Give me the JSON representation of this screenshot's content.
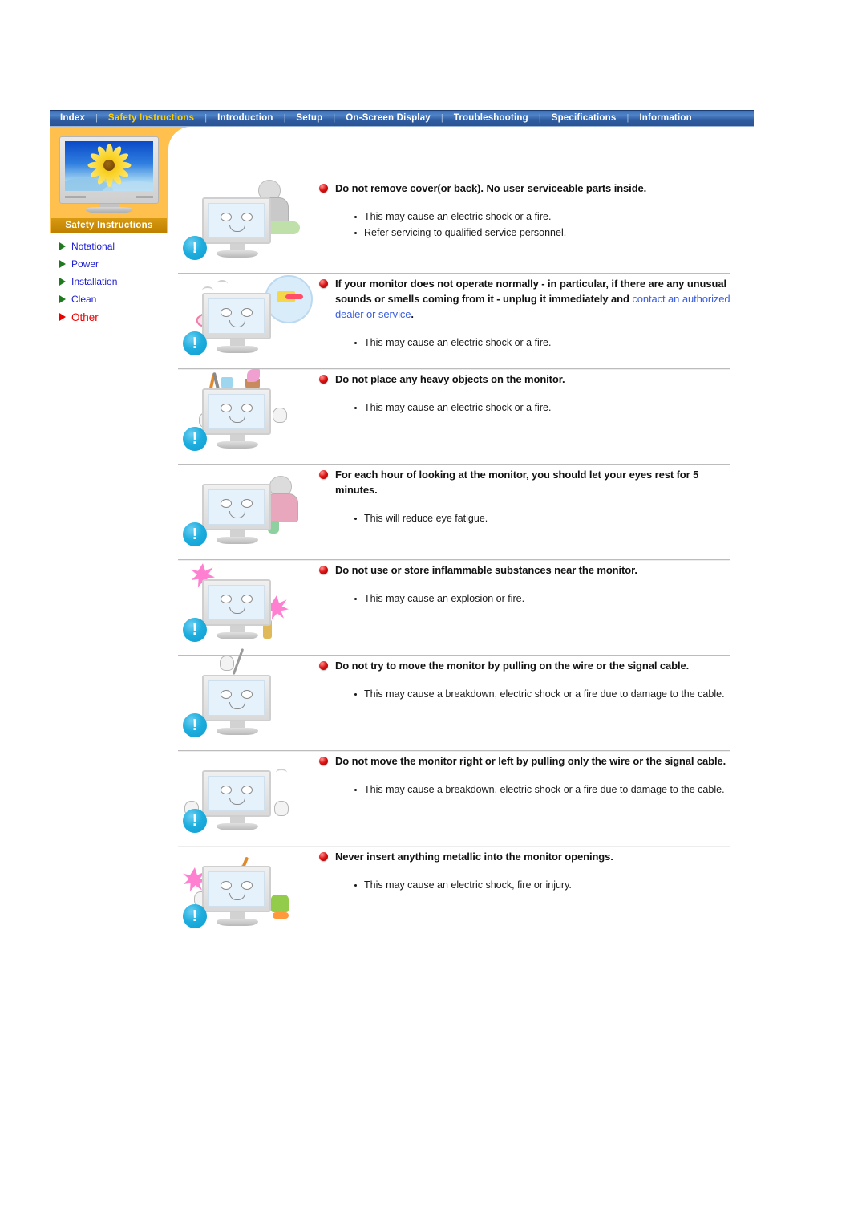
{
  "nav": {
    "separator": "|",
    "items": [
      {
        "label": "Index",
        "active": false
      },
      {
        "label": "Safety Instructions",
        "active": true
      },
      {
        "label": "Introduction",
        "active": false
      },
      {
        "label": "Setup",
        "active": false
      },
      {
        "label": "On-Screen Display",
        "active": false
      },
      {
        "label": "Troubleshooting",
        "active": false
      },
      {
        "label": "Specifications",
        "active": false
      },
      {
        "label": "Information",
        "active": false
      }
    ]
  },
  "sidebar": {
    "banner_label": "Safety Instructions",
    "thumbnail_alt": "monitor-with-sunflower-wallpaper",
    "items": [
      {
        "label": "Notational",
        "current": false
      },
      {
        "label": "Power",
        "current": false
      },
      {
        "label": "Installation",
        "current": false
      },
      {
        "label": "Clean",
        "current": false
      },
      {
        "label": "Other",
        "current": true
      }
    ]
  },
  "colors": {
    "nav_bar_blue": "#3f6fb5",
    "nav_active_yellow": "#ffd000",
    "sidebar_orange": "#ffc04d",
    "banner_gold": "#c08000",
    "link_blue": "#3b5fe0",
    "side_link_blue": "#1c1cd0",
    "current_red": "#ee0000",
    "heading_orb_red": "#e01515",
    "warn_icon_blue": "#1eaede",
    "rule_grey": "#bcbcbc"
  },
  "sections": [
    {
      "icon": "blue-exclamation-icon",
      "illustration": "technician-opening-monitor-cover",
      "heading": "Do not remove cover(or back). No user serviceable parts inside.",
      "heading_link": "",
      "heading_tail": "",
      "bullets": [
        "This may cause an electric shock or a fire.",
        "Refer servicing to qualified service personnel."
      ]
    },
    {
      "icon": "blue-exclamation-icon",
      "illustration": "monitor-smoking-unplug-and-call-service",
      "heading": "If your monitor does not operate normally - in particular, if there are any unusual sounds or smells coming from it - unplug it immediately and ",
      "heading_link": "contact an authorized dealer or service",
      "heading_tail": ".",
      "bullets": [
        "This may cause an electric shock or a fire."
      ]
    },
    {
      "icon": "blue-exclamation-icon",
      "illustration": "angry-monitor-with-objects-on-top",
      "heading": "Do not place any heavy objects on the monitor.",
      "heading_link": "",
      "heading_tail": "",
      "bullets": [
        "This may cause an electric shock or a fire."
      ]
    },
    {
      "icon": "blue-exclamation-icon",
      "illustration": "person-resting-eyes-beside-monitor",
      "heading": "For each hour of looking at the monitor, you should let your eyes rest for 5 minutes.",
      "heading_link": "",
      "heading_tail": "",
      "bullets": [
        "This will reduce eye fatigue."
      ]
    },
    {
      "icon": "blue-exclamation-icon",
      "illustration": "inflammable-substances-explosion-near-monitor",
      "heading": "Do not use or store inflammable substances near the monitor.",
      "heading_link": "",
      "heading_tail": "",
      "bullets": [
        "This may cause an explosion or fire."
      ]
    },
    {
      "icon": "blue-exclamation-icon",
      "illustration": "monitor-pulled-by-cable",
      "heading": "Do not try to move the monitor by pulling on the wire or the signal cable.",
      "heading_link": "",
      "heading_tail": "",
      "bullets": [
        "This may cause a breakdown, electric shock or a fire due to damage to the cable."
      ]
    },
    {
      "icon": "blue-exclamation-icon",
      "illustration": "monitor-dragged-sideways-by-cable",
      "heading": "Do not move the monitor right or left by pulling only the wire or the signal cable.",
      "heading_link": "",
      "heading_tail": "",
      "bullets": [
        "This may cause a breakdown, electric shock or a fire due to damage to the cable."
      ]
    },
    {
      "icon": "blue-exclamation-icon",
      "illustration": "metal-object-inserted-into-monitor-opening",
      "heading": "Never insert anything metallic into the monitor openings.",
      "heading_link": "",
      "heading_tail": "",
      "bullets": [
        "This may cause an electric shock, fire or injury."
      ]
    }
  ]
}
